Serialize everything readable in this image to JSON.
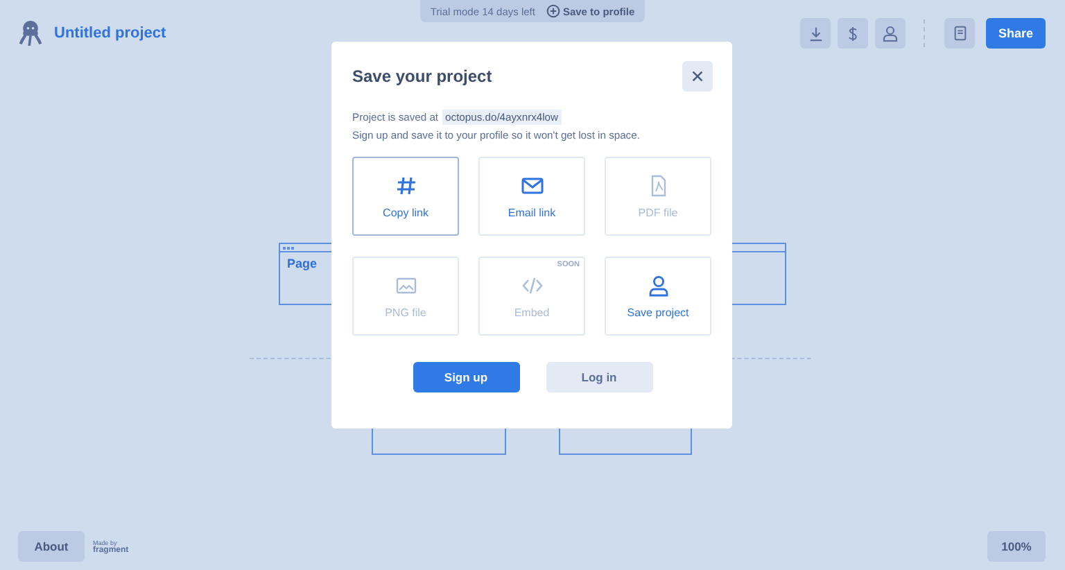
{
  "header": {
    "title": "Untitled project",
    "share": "Share"
  },
  "trial": {
    "text": "Trial mode 14 days left",
    "action": "Save to profile"
  },
  "canvas": {
    "nodes": [
      {
        "title": "Page"
      }
    ]
  },
  "modal": {
    "title": "Save your project",
    "saved_text": "Project is saved at",
    "link": "octopus.do/4ayxnrx4low",
    "subtitle": "Sign up and save it to your profile so it won't get lost in space.",
    "options": [
      {
        "kind": "hash",
        "label": "Copy link",
        "selected": true,
        "disabled": false
      },
      {
        "kind": "mail",
        "label": "Email link",
        "selected": false,
        "disabled": false
      },
      {
        "kind": "pdf",
        "label": "PDF file",
        "selected": false,
        "disabled": true
      },
      {
        "kind": "image",
        "label": "PNG file",
        "selected": false,
        "disabled": true
      },
      {
        "kind": "code",
        "label": "Embed",
        "selected": false,
        "disabled": true,
        "badge": "SOON"
      },
      {
        "kind": "user",
        "label": "Save project",
        "selected": false,
        "disabled": false
      }
    ],
    "primary": "Sign up",
    "secondary": "Log in"
  },
  "footer": {
    "about": "About",
    "made_by": "Made by",
    "brand": "fragment",
    "zoom": "100%"
  }
}
